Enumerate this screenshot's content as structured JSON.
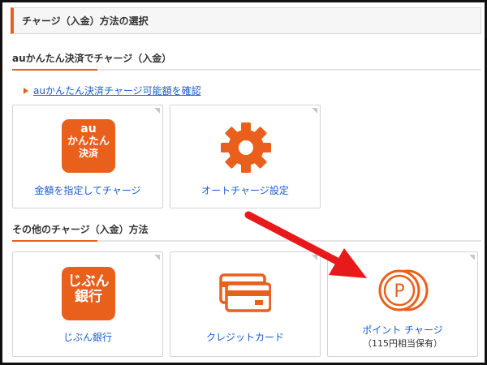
{
  "header": {
    "title": "チャージ（入金）方法の選択"
  },
  "section_au": {
    "title": "auかんたん決済でチャージ（入金）",
    "link_label": "auかんたん決済チャージ可能額を確認",
    "tiles": [
      {
        "icon": "au-kantan-kessai-icon",
        "icon_lines": [
          "au",
          "かんたん",
          "決済"
        ],
        "caption": "金額を指定してチャージ"
      },
      {
        "icon": "gear-icon",
        "caption": "オートチャージ設定"
      }
    ]
  },
  "section_other": {
    "title": "その他のチャージ（入金）方法",
    "tiles": [
      {
        "icon": "jibun-bank-icon",
        "icon_lines": [
          "じぶん",
          "銀行"
        ],
        "caption": "じぶん銀行"
      },
      {
        "icon": "credit-card-icon",
        "caption": "クレジットカード"
      },
      {
        "icon": "point-coin-icon",
        "icon_letter": "P",
        "caption": "ポイント チャージ",
        "sub_caption": "（115円相当保有）"
      }
    ]
  },
  "colors": {
    "accent": "#e8601c",
    "link": "#1a5ccc",
    "arrow": "#e8191b"
  }
}
